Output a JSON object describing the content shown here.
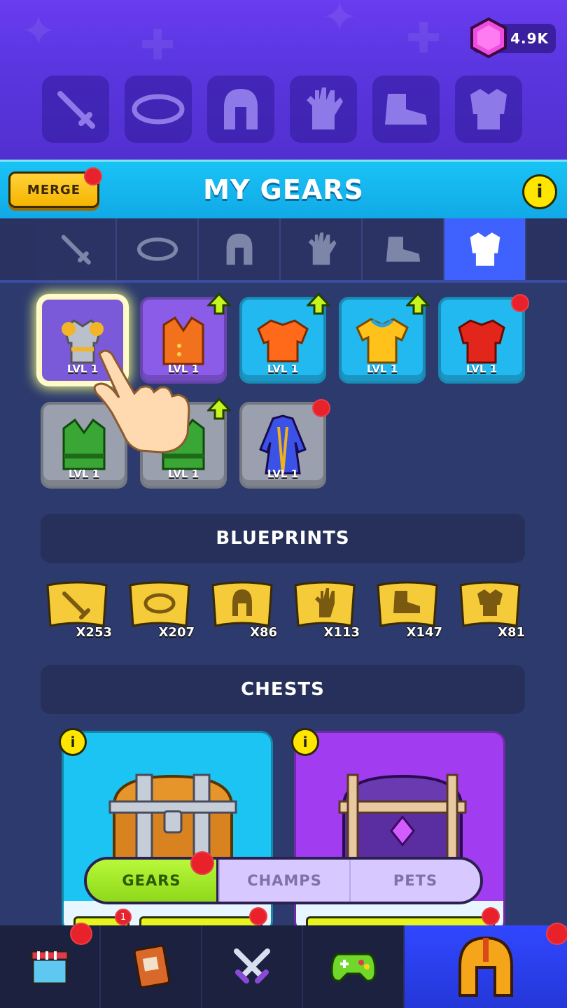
{
  "currency": {
    "gems": "4.9K",
    "icon": "gem-icon",
    "color": "#e43bd8"
  },
  "equip_slots": [
    "sword-icon",
    "ring-icon",
    "helmet-icon",
    "glove-icon",
    "boot-icon",
    "armor-icon"
  ],
  "header": {
    "merge_label": "MERGE",
    "title": "MY GEARS",
    "info_label": "i"
  },
  "category_tabs": [
    {
      "icon": "sword-icon",
      "active": false
    },
    {
      "icon": "ring-icon",
      "active": false
    },
    {
      "icon": "helmet-icon",
      "active": false
    },
    {
      "icon": "glove-icon",
      "active": false
    },
    {
      "icon": "boot-icon",
      "active": false
    },
    {
      "icon": "armor-icon",
      "active": true
    }
  ],
  "gears": [
    {
      "name": "steel-armor",
      "level": "LVL 1",
      "rarity": "#7b5ad9",
      "selected": true,
      "upgrade": false,
      "dot": false
    },
    {
      "name": "orange-vest",
      "level": "LVL 1",
      "rarity": "#8b5ce8",
      "selected": false,
      "upgrade": true,
      "dot": false
    },
    {
      "name": "orange-breastplate",
      "level": "LVL 1",
      "rarity": "#22b8f0",
      "selected": false,
      "upgrade": true,
      "dot": false
    },
    {
      "name": "yellow-tunic",
      "level": "LVL 1",
      "rarity": "#22b8f0",
      "selected": false,
      "upgrade": true,
      "dot": false
    },
    {
      "name": "red-armor",
      "level": "LVL 1",
      "rarity": "#22b8f0",
      "selected": false,
      "upgrade": false,
      "dot": true
    },
    {
      "name": "green-vest",
      "level": "LVL 1",
      "rarity": "#9aa0ad",
      "selected": false,
      "upgrade": false,
      "dot": false
    },
    {
      "name": "green-vest-2",
      "level": "LVL 1",
      "rarity": "#9aa0ad",
      "selected": false,
      "upgrade": true,
      "dot": false
    },
    {
      "name": "wizard-robe",
      "level": "LVL 1",
      "rarity": "#9aa0ad",
      "selected": false,
      "upgrade": false,
      "dot": true
    }
  ],
  "blueprints": {
    "title": "BLUEPRINTS",
    "items": [
      {
        "icon": "sword-icon",
        "count": "X253"
      },
      {
        "icon": "ring-icon",
        "count": "X207"
      },
      {
        "icon": "helmet-icon",
        "count": "X86"
      },
      {
        "icon": "glove-icon",
        "count": "X113"
      },
      {
        "icon": "boot-icon",
        "count": "X147"
      },
      {
        "icon": "armor-icon",
        "count": "X81"
      }
    ]
  },
  "chests": {
    "title": "CHESTS",
    "items": [
      {
        "type": "wooden-chest",
        "color": "#1bc4f2",
        "badge": "1"
      },
      {
        "type": "purple-chest",
        "color": "#a23cf0",
        "badge": ""
      }
    ]
  },
  "segment": {
    "tabs": [
      "GEARS",
      "CHAMPS",
      "PETS"
    ],
    "active": "GEARS"
  },
  "bottom_nav": [
    {
      "icon": "shop-icon",
      "active": false
    },
    {
      "icon": "book-icon",
      "active": false
    },
    {
      "icon": "crossed-swords-icon",
      "active": false
    },
    {
      "icon": "gamepad-icon",
      "active": false
    },
    {
      "icon": "helmet-icon",
      "active": true
    }
  ]
}
